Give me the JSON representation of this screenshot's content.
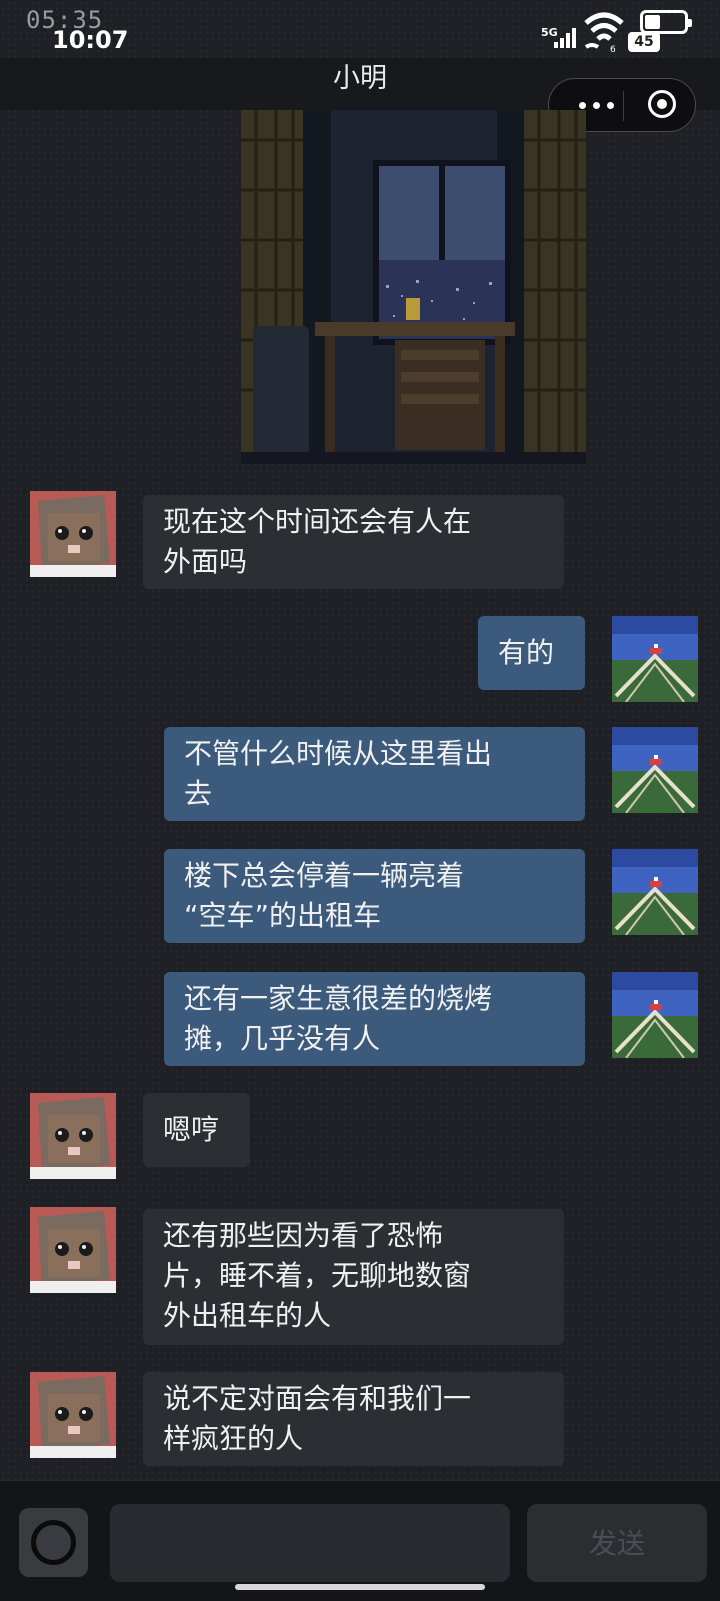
{
  "status_bar": {
    "overlay_time": "05:35",
    "time": "10:07",
    "network": "5G",
    "battery": "45",
    "battery_level": 0.45
  },
  "nav": {
    "title": "小明"
  },
  "messages": [
    {
      "side": "left",
      "lines": [
        "现在这个时间还会有人在",
        "外面吗"
      ]
    },
    {
      "side": "right",
      "lines": [
        "有的"
      ]
    },
    {
      "side": "right",
      "lines": [
        "不管什么时候从这里看出",
        "去"
      ]
    },
    {
      "side": "right",
      "lines": [
        "楼下总会停着一辆亮着",
        "“空车”的出租车"
      ]
    },
    {
      "side": "right",
      "lines": [
        "还有一家生意很差的烧烤",
        "摊，几乎没有人"
      ]
    },
    {
      "side": "left",
      "lines": [
        "嗯哼"
      ]
    },
    {
      "side": "left",
      "lines": [
        "还有那些因为看了恐怖",
        "片，睡不着，无聊地数窗",
        "外出租车的人"
      ]
    },
    {
      "side": "left",
      "lines": [
        "说不定对面会有和我们一",
        "样疯狂的人"
      ]
    }
  ],
  "input": {
    "value": "",
    "send_label": "发送"
  },
  "colors": {
    "background": "#1f2025",
    "bubble_left": "#2d2e34",
    "bubble_right": "#3b5a7c",
    "text": "#f0f0f0"
  },
  "icons": {
    "more": "more-dots-icon",
    "close": "target-circle-icon",
    "camera": "camera-icon",
    "friend_avatar": "cat-avatar-icon",
    "self_avatar": "landscape-avatar-icon"
  }
}
